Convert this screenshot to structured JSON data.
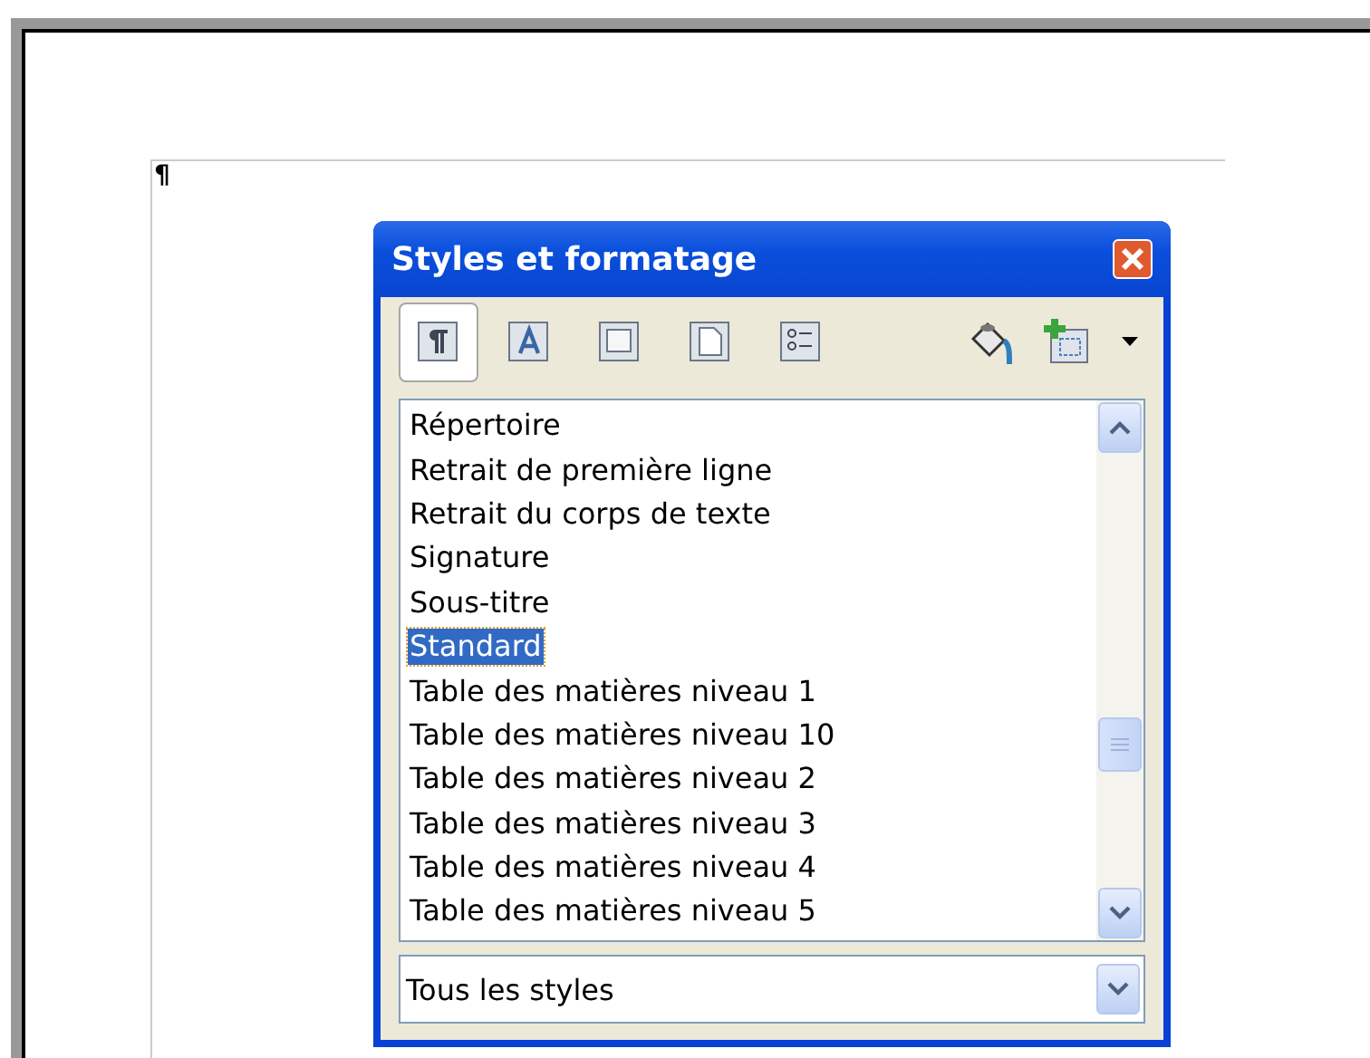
{
  "document": {
    "paragraph_mark": "¶"
  },
  "dialog": {
    "title": "Styles et formatage",
    "families": [
      {
        "kind": "paragraph",
        "selected": true
      },
      {
        "kind": "character",
        "selected": false
      },
      {
        "kind": "frame",
        "selected": false
      },
      {
        "kind": "page",
        "selected": false
      },
      {
        "kind": "list",
        "selected": false
      }
    ],
    "styles": [
      {
        "label": "Répertoire",
        "selected": false
      },
      {
        "label": "Retrait de première ligne",
        "selected": false
      },
      {
        "label": "Retrait du corps de texte",
        "selected": false
      },
      {
        "label": "Signature",
        "selected": false
      },
      {
        "label": "Sous-titre",
        "selected": false
      },
      {
        "label": "Standard",
        "selected": true
      },
      {
        "label": "Table des matières niveau 1",
        "selected": false
      },
      {
        "label": "Table des matières niveau 10",
        "selected": false
      },
      {
        "label": "Table des matières niveau 2",
        "selected": false
      },
      {
        "label": "Table des matières niveau 3",
        "selected": false
      },
      {
        "label": "Table des matières niveau 4",
        "selected": false
      },
      {
        "label": "Table des matières niveau 5",
        "selected": false
      }
    ],
    "filter": {
      "value": "Tous les styles"
    }
  }
}
